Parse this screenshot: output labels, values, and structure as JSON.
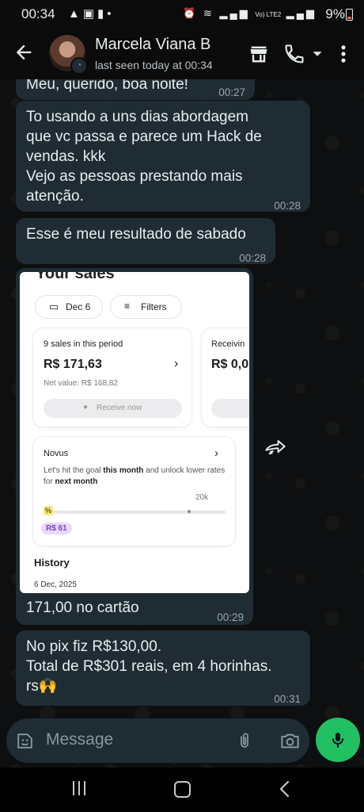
{
  "status_bar": {
    "time": "00:34",
    "network_label": "Vo) LTE2",
    "battery": "9%"
  },
  "header": {
    "contact_name": "Marcela Viana B",
    "last_seen": "last seen today at 00:34",
    "icons": [
      "back-arrow-icon",
      "avatar",
      "store-icon",
      "phone-icon",
      "caret-down-icon",
      "more-vert-icon"
    ]
  },
  "messages": [
    {
      "text": "Meu, querido, boa noite!",
      "time": "00:27"
    },
    {
      "text": "To usando a uns dias abordagem\nque vc passa e parece um Hack de\nvendas. kkk\nVejo as pessoas prestando mais\natenção.",
      "time": "00:28"
    },
    {
      "text": "Esse é meu resultado de sabado",
      "time": "00:28"
    },
    {
      "text": "171,00 no cartão",
      "time": "00:29"
    },
    {
      "text": "No pix fiz R$130,00.\nTotal de R$301 reais, em 4 horinhas.\nrs🙌",
      "time": "00:31"
    }
  ],
  "screenshot": {
    "heading": "Your sales",
    "date_chip": "Dec 6",
    "filters_chip": "Filters",
    "sales_card": {
      "title": "9 sales in this period",
      "amount": "R$ 171,63",
      "net_value": "Net value: R$ 168,82",
      "button": "Receive now"
    },
    "receiving_card": {
      "title": "Receivin",
      "amount": "R$ 0,0"
    },
    "novus_card": {
      "title": "Novus",
      "description_pre": "Let's hit the goal ",
      "description_bold1": "this month",
      "description_mid": " and unlock lower rates for ",
      "description_bold2": "next month",
      "goal_label": "20k",
      "badge": "R$ 61",
      "progress_fraction": 0.03
    },
    "history_title": "History",
    "history_date": "6 Dec, 2025"
  },
  "composer": {
    "placeholder": "Message"
  },
  "colors": {
    "bubble": "#1f2c34",
    "accent_green": "#21c063",
    "text_time": "#9aa4aa"
  }
}
